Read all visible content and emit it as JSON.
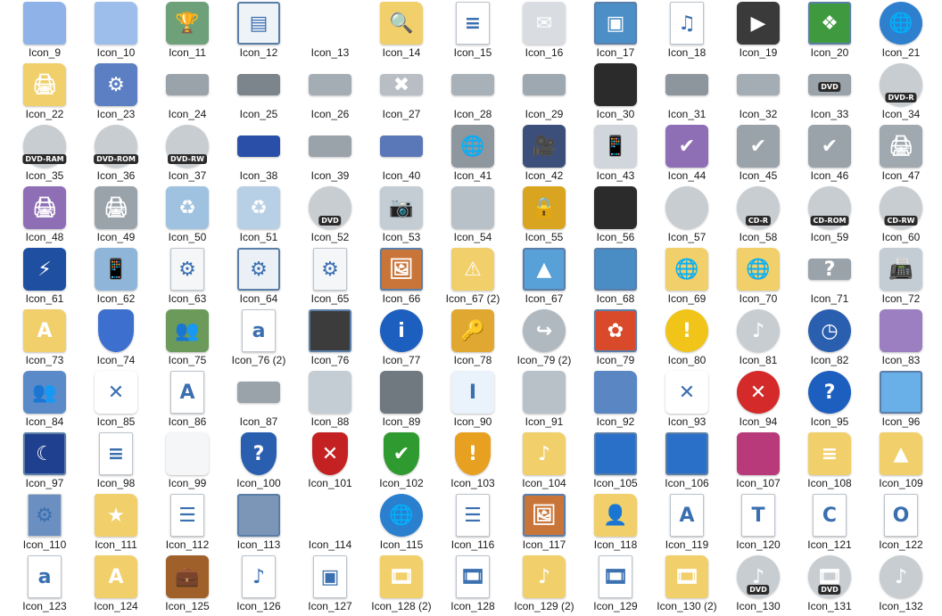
{
  "icons": [
    {
      "label": "Icon_9",
      "icon": "folder-icon",
      "glyph": "",
      "color": "#8fb3e8"
    },
    {
      "label": "Icon_10",
      "icon": "folder-icon",
      "glyph": "",
      "color": "#9dbdea"
    },
    {
      "label": "Icon_11",
      "icon": "trophy-icon",
      "glyph": "🏆",
      "color": "#6ea07a"
    },
    {
      "label": "Icon_12",
      "icon": "window-icon",
      "glyph": "▤",
      "color": "#eef3f7"
    },
    {
      "label": "Icon_13",
      "icon": "blank-icon",
      "glyph": "",
      "color": ""
    },
    {
      "label": "Icon_14",
      "icon": "folder-search-icon",
      "glyph": "🔍",
      "color": "#f1cf6a"
    },
    {
      "label": "Icon_15",
      "icon": "document-icon",
      "glyph": "≡",
      "color": "#ffffff"
    },
    {
      "label": "Icon_16",
      "icon": "envelope-icon",
      "glyph": "✉",
      "color": "#d9dde2"
    },
    {
      "label": "Icon_17",
      "icon": "picture-icon",
      "glyph": "▣",
      "color": "#4c8fc7"
    },
    {
      "label": "Icon_18",
      "icon": "sheet-music-icon",
      "glyph": "♫",
      "color": "#ffffff"
    },
    {
      "label": "Icon_19",
      "icon": "video-icon",
      "glyph": "▶",
      "color": "#3a3a3a"
    },
    {
      "label": "Icon_20",
      "icon": "windows-logo-icon",
      "glyph": "❖",
      "color": "#3f9a3f"
    },
    {
      "label": "Icon_21",
      "icon": "globe-monitor-icon",
      "glyph": "🌐",
      "color": "#2f7fcf"
    },
    {
      "label": "Icon_22",
      "icon": "printer-folder-icon",
      "glyph": "🖨",
      "color": "#f1cf6a"
    },
    {
      "label": "Icon_23",
      "icon": "control-panel-icon",
      "glyph": "⚙",
      "color": "#5b7fc2"
    },
    {
      "label": "Icon_24",
      "icon": "floppy-drive-icon",
      "glyph": "",
      "color": "#9aa2aa"
    },
    {
      "label": "Icon_25",
      "icon": "floppy-drive-icon",
      "glyph": "",
      "color": "#7c848c"
    },
    {
      "label": "Icon_26",
      "icon": "cd-drive-icon",
      "glyph": "",
      "color": "#a4acb4"
    },
    {
      "label": "Icon_27",
      "icon": "drive-error-icon",
      "glyph": "✖",
      "color": "#b8bec4"
    },
    {
      "label": "Icon_28",
      "icon": "drive-icon",
      "glyph": "",
      "color": "#a8b0b8"
    },
    {
      "label": "Icon_29",
      "icon": "network-drive-icon",
      "glyph": "",
      "color": "#9ea8b0"
    },
    {
      "label": "Icon_30",
      "icon": "memory-chip-icon",
      "glyph": "",
      "color": "#2b2b2b"
    },
    {
      "label": "Icon_31",
      "icon": "drive-icon",
      "glyph": "",
      "color": "#8d959d"
    },
    {
      "label": "Icon_32",
      "icon": "windows-drive-icon",
      "glyph": "",
      "color": "#a4acb4"
    },
    {
      "label": "Icon_33",
      "icon": "dvd-drive-icon",
      "glyph": "",
      "color": "#9aa2aa",
      "badge": "DVD"
    },
    {
      "label": "Icon_34",
      "icon": "dvd-r-disc-icon",
      "glyph": "",
      "color": "#c8cdd2",
      "badge": "DVD-R"
    },
    {
      "label": "Icon_35",
      "icon": "dvd-ram-disc-icon",
      "glyph": "",
      "color": "#c8cdd2",
      "badge": "DVD-RAM"
    },
    {
      "label": "Icon_36",
      "icon": "dvd-rom-disc-icon",
      "glyph": "",
      "color": "#c8cdd2",
      "badge": "DVD-ROM"
    },
    {
      "label": "Icon_37",
      "icon": "dvd-rw-disc-icon",
      "glyph": "",
      "color": "#c8cdd2",
      "badge": "DVD-RW"
    },
    {
      "label": "Icon_38",
      "icon": "blue-drive-icon",
      "glyph": "",
      "color": "#2a4fa8"
    },
    {
      "label": "Icon_39",
      "icon": "tape-drive-icon",
      "glyph": "",
      "color": "#9aa2aa"
    },
    {
      "label": "Icon_40",
      "icon": "zip-drive-icon",
      "glyph": "",
      "color": "#5a78b8"
    },
    {
      "label": "Icon_41",
      "icon": "network-printer-icon",
      "glyph": "🌐",
      "color": "#8e969e"
    },
    {
      "label": "Icon_42",
      "icon": "camcorder-icon",
      "glyph": "🎥",
      "color": "#3b4f7a"
    },
    {
      "label": "Icon_43",
      "icon": "mobile-phone-icon",
      "glyph": "📱",
      "color": "#d0d6dc"
    },
    {
      "label": "Icon_44",
      "icon": "fax-check-icon",
      "glyph": "✔",
      "color": "#8e6fb5"
    },
    {
      "label": "Icon_45",
      "icon": "printer-check-icon",
      "glyph": "✔",
      "color": "#9aa2aa"
    },
    {
      "label": "Icon_46",
      "icon": "network-printer-check-icon",
      "glyph": "✔",
      "color": "#9aa2aa"
    },
    {
      "label": "Icon_47",
      "icon": "printer-icon",
      "glyph": "🖨",
      "color": "#a0a8b0"
    },
    {
      "label": "Icon_48",
      "icon": "fax-printer-icon",
      "glyph": "🖨",
      "color": "#8e6fb5"
    },
    {
      "label": "Icon_49",
      "icon": "network-printer-icon",
      "glyph": "🖨",
      "color": "#9aa2aa"
    },
    {
      "label": "Icon_50",
      "icon": "recycle-bin-full-icon",
      "glyph": "♻",
      "color": "#9fc2e0"
    },
    {
      "label": "Icon_51",
      "icon": "recycle-bin-empty-icon",
      "glyph": "♻",
      "color": "#b7d0e6"
    },
    {
      "label": "Icon_52",
      "icon": "dvd-disc-icon",
      "glyph": "",
      "color": "#c8cdd2",
      "badge": "DVD"
    },
    {
      "label": "Icon_53",
      "icon": "camera-icon",
      "glyph": "📷",
      "color": "#c4ccd4"
    },
    {
      "label": "Icon_54",
      "icon": "mouse-icon",
      "glyph": "",
      "color": "#b8c0c8"
    },
    {
      "label": "Icon_55",
      "icon": "padlock-icon",
      "glyph": "🔒",
      "color": "#d9a521"
    },
    {
      "label": "Icon_56",
      "icon": "memory-card-icon",
      "glyph": "",
      "color": "#2b2b2b"
    },
    {
      "label": "Icon_57",
      "icon": "cd-disc-icon",
      "glyph": "",
      "color": "#c8cdd2"
    },
    {
      "label": "Icon_58",
      "icon": "cd-r-disc-icon",
      "glyph": "",
      "color": "#c8cdd2",
      "badge": "CD-R"
    },
    {
      "label": "Icon_59",
      "icon": "cd-rom-disc-icon",
      "glyph": "",
      "color": "#c8cdd2",
      "badge": "CD-ROM"
    },
    {
      "label": "Icon_60",
      "icon": "cd-rw-disc-icon",
      "glyph": "",
      "color": "#c8cdd2",
      "badge": "CD-RW"
    },
    {
      "label": "Icon_61",
      "icon": "blue-panel-icon",
      "glyph": "⚡",
      "color": "#1f4fa0"
    },
    {
      "label": "Icon_62",
      "icon": "pda-phone-icon",
      "glyph": "📱",
      "color": "#8fb5d8"
    },
    {
      "label": "Icon_63",
      "icon": "settings-doc-icon",
      "glyph": "⚙",
      "color": "#f4f6f8"
    },
    {
      "label": "Icon_64",
      "icon": "settings-window-icon",
      "glyph": "⚙",
      "color": "#eaf0f6"
    },
    {
      "label": "Icon_65",
      "icon": "settings-doc-icon",
      "glyph": "⚙",
      "color": "#f4f6f8"
    },
    {
      "label": "Icon_66",
      "icon": "picture-frame-icon",
      "glyph": "🖼",
      "color": "#c9753a"
    },
    {
      "label": "Icon_67 (2)",
      "icon": "folder-warning-icon",
      "glyph": "⚠",
      "color": "#f1cf6a"
    },
    {
      "label": "Icon_67",
      "icon": "landscape-picture-icon",
      "glyph": "▲",
      "color": "#58a0d8"
    },
    {
      "label": "Icon_68",
      "icon": "landscape-picture-icon",
      "glyph": "",
      "color": "#4a8cc4"
    },
    {
      "label": "Icon_69",
      "icon": "network-folder-icon",
      "glyph": "🌐",
      "color": "#f1cf6a"
    },
    {
      "label": "Icon_70",
      "icon": "network-folder-icon",
      "glyph": "🌐",
      "color": "#f1cf6a"
    },
    {
      "label": "Icon_71",
      "icon": "drive-question-icon",
      "glyph": "?",
      "color": "#9aa2aa"
    },
    {
      "label": "Icon_72",
      "icon": "fax-machine-icon",
      "glyph": "📠",
      "color": "#c4ccd4"
    },
    {
      "label": "Icon_73",
      "icon": "fonts-folder-icon",
      "glyph": "A",
      "color": "#f1cf6a"
    },
    {
      "label": "Icon_74",
      "icon": "uac-shield-icon",
      "glyph": "",
      "color": "#3d6fcf"
    },
    {
      "label": "Icon_75",
      "icon": "users-icon",
      "glyph": "👥",
      "color": "#6b9a5a"
    },
    {
      "label": "Icon_76 (2)",
      "icon": "font-file-icon",
      "glyph": "a",
      "color": "#ffffff"
    },
    {
      "label": "Icon_76",
      "icon": "server-windows-icon",
      "glyph": "",
      "color": "#3c3c3c"
    },
    {
      "label": "Icon_77",
      "icon": "info-icon",
      "glyph": "i",
      "color": "#1d5fbf"
    },
    {
      "label": "Icon_78",
      "icon": "key-icon",
      "glyph": "🔑",
      "color": "#e0a830"
    },
    {
      "label": "Icon_79 (2)",
      "icon": "cd-drive-arrow-icon",
      "glyph": "↪",
      "color": "#b0b8c0"
    },
    {
      "label": "Icon_79",
      "icon": "flowers-picture-icon",
      "glyph": "✿",
      "color": "#d84a2a"
    },
    {
      "label": "Icon_80",
      "icon": "warning-icon",
      "glyph": "!",
      "color": "#f0c419"
    },
    {
      "label": "Icon_81",
      "icon": "music-cd-icon",
      "glyph": "♪",
      "color": "#c8cdd2"
    },
    {
      "label": "Icon_82",
      "icon": "clock-icon",
      "glyph": "◷",
      "color": "#2a5fb0"
    },
    {
      "label": "Icon_83",
      "icon": "cd-package-icon",
      "glyph": "",
      "color": "#9b7fc0"
    },
    {
      "label": "Icon_84",
      "icon": "users-icon",
      "glyph": "👥",
      "color": "#5a8ac8"
    },
    {
      "label": "Icon_85",
      "icon": "red-x-icon",
      "glyph": "✕",
      "color": "#ffffff"
    },
    {
      "label": "Icon_86",
      "icon": "document-font-icon",
      "glyph": "A",
      "color": "#ffffff"
    },
    {
      "label": "Icon_87",
      "icon": "drive-device-icon",
      "glyph": "",
      "color": "#9aa2aa"
    },
    {
      "label": "Icon_88",
      "icon": "scanner-glass-icon",
      "glyph": "",
      "color": "#c4ccd4"
    },
    {
      "label": "Icon_89",
      "icon": "pda-icon",
      "glyph": "",
      "color": "#707880"
    },
    {
      "label": "Icon_90",
      "icon": "text-field-icon",
      "glyph": "I",
      "color": "#eaf2fb"
    },
    {
      "label": "Icon_91",
      "icon": "flatbed-scanner-icon",
      "glyph": "",
      "color": "#b8c0c8"
    },
    {
      "label": "Icon_92",
      "icon": "blue-folder-icon",
      "glyph": "",
      "color": "#5a86c4"
    },
    {
      "label": "Icon_93",
      "icon": "gray-x-icon",
      "glyph": "✕",
      "color": "#ffffff"
    },
    {
      "label": "Icon_94",
      "icon": "error-icon",
      "glyph": "✕",
      "color": "#d42a2a"
    },
    {
      "label": "Icon_95",
      "icon": "help-icon",
      "glyph": "?",
      "color": "#1d5fbf"
    },
    {
      "label": "Icon_96",
      "icon": "window-stack-icon",
      "glyph": "",
      "color": "#6ab0e8"
    },
    {
      "label": "Icon_97",
      "icon": "monitor-moon-icon",
      "glyph": "☾",
      "color": "#1f3f8f"
    },
    {
      "label": "Icon_98",
      "icon": "text-document-icon",
      "glyph": "≡",
      "color": "#ffffff"
    },
    {
      "label": "Icon_99",
      "icon": "projector-screen-icon",
      "glyph": "",
      "color": "#f4f6f8"
    },
    {
      "label": "Icon_100",
      "icon": "shield-question-icon",
      "glyph": "?",
      "color": "#2a5fb0"
    },
    {
      "label": "Icon_101",
      "icon": "shield-error-icon",
      "glyph": "✕",
      "color": "#c42222"
    },
    {
      "label": "Icon_102",
      "icon": "shield-check-icon",
      "glyph": "✔",
      "color": "#2f9a2f"
    },
    {
      "label": "Icon_103",
      "icon": "shield-warning-icon",
      "glyph": "!",
      "color": "#e8a020"
    },
    {
      "label": "Icon_104",
      "icon": "music-folder-icon",
      "glyph": "♪",
      "color": "#f1cf6a"
    },
    {
      "label": "Icon_105",
      "icon": "computer-icon",
      "glyph": "",
      "color": "#2a6fc8"
    },
    {
      "label": "Icon_106",
      "icon": "monitor-icon",
      "glyph": "",
      "color": "#2a6fc8"
    },
    {
      "label": "Icon_107",
      "icon": "software-box-icon",
      "glyph": "",
      "color": "#b83a7a"
    },
    {
      "label": "Icon_108",
      "icon": "documents-folder-icon",
      "glyph": "≡",
      "color": "#f1cf6a"
    },
    {
      "label": "Icon_109",
      "icon": "pictures-folder-icon",
      "glyph": "▲",
      "color": "#f1cf6a"
    },
    {
      "label": "Icon_110",
      "icon": "settings-list-icon",
      "glyph": "⚙",
      "color": "#6a8fc0"
    },
    {
      "label": "Icon_111",
      "icon": "favorites-folder-icon",
      "glyph": "★",
      "color": "#f1cf6a"
    },
    {
      "label": "Icon_112",
      "icon": "checklist-icon",
      "glyph": "☰",
      "color": "#ffffff"
    },
    {
      "label": "Icon_113",
      "icon": "network-computers-icon",
      "glyph": "",
      "color": "#7c96b8"
    },
    {
      "label": "Icon_114",
      "icon": "blank-icon",
      "glyph": "",
      "color": ""
    },
    {
      "label": "Icon_115",
      "icon": "network-globe-icon",
      "glyph": "🌐",
      "color": "#2a7fcf"
    },
    {
      "label": "Icon_116",
      "icon": "tasks-list-icon",
      "glyph": "☰",
      "color": "#ffffff"
    },
    {
      "label": "Icon_117",
      "icon": "picture-frame-icon",
      "glyph": "🖼",
      "color": "#c9753a"
    },
    {
      "label": "Icon_118",
      "icon": "user-folder-icon",
      "glyph": "👤",
      "color": "#f1cf6a"
    },
    {
      "label": "Icon_119",
      "icon": "font-document-icon",
      "glyph": "A",
      "color": "#ffffff"
    },
    {
      "label": "Icon_120",
      "icon": "truetype-font-icon",
      "glyph": "T",
      "color": "#ffffff"
    },
    {
      "label": "Icon_121",
      "icon": "font-tc-icon",
      "glyph": "C",
      "color": "#ffffff"
    },
    {
      "label": "Icon_122",
      "icon": "opentype-font-icon",
      "glyph": "O",
      "color": "#ffffff"
    },
    {
      "label": "Icon_123",
      "icon": "font-file-icon",
      "glyph": "a",
      "color": "#ffffff"
    },
    {
      "label": "Icon_124",
      "icon": "fonts-folder-icon",
      "glyph": "A",
      "color": "#f1cf6a"
    },
    {
      "label": "Icon_125",
      "icon": "user-briefcase-icon",
      "glyph": "💼",
      "color": "#a0602a"
    },
    {
      "label": "Icon_126",
      "icon": "audio-file-icon",
      "glyph": "♪",
      "color": "#ffffff"
    },
    {
      "label": "Icon_127",
      "icon": "image-file-icon",
      "glyph": "▣",
      "color": "#ffffff"
    },
    {
      "label": "Icon_128 (2)",
      "icon": "video-folder-icon",
      "glyph": "🎞",
      "color": "#f1cf6a"
    },
    {
      "label": "Icon_128",
      "icon": "video-file-icon",
      "glyph": "🎞",
      "color": "#ffffff"
    },
    {
      "label": "Icon_129 (2)",
      "icon": "music-folder-icon",
      "glyph": "♪",
      "color": "#f1cf6a"
    },
    {
      "label": "Icon_129",
      "icon": "video-file-icon",
      "glyph": "🎞",
      "color": "#ffffff"
    },
    {
      "label": "Icon_130 (2)",
      "icon": "video-folder-icon",
      "glyph": "🎞",
      "color": "#f1cf6a"
    },
    {
      "label": "Icon_130",
      "icon": "dvd-music-icon",
      "glyph": "♪",
      "color": "#c8cdd2",
      "badge": "DVD"
    },
    {
      "label": "Icon_131",
      "icon": "dvd-video-icon",
      "glyph": "🎞",
      "color": "#c8cdd2",
      "badge": "DVD"
    },
    {
      "label": "Icon_132",
      "icon": "music-cd-icon",
      "glyph": "♪",
      "color": "#c8cdd2"
    }
  ]
}
